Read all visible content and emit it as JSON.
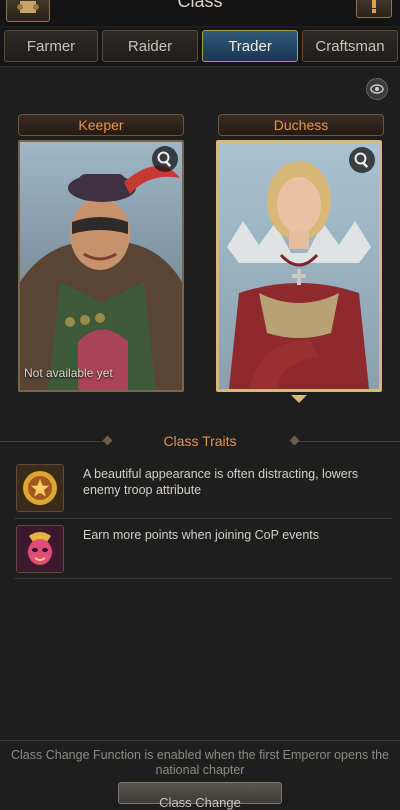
{
  "header": {
    "title": "Class",
    "back_icon": "scroll-icon",
    "info_icon": "info-icon"
  },
  "tabs": [
    {
      "label": "Farmer",
      "active": false
    },
    {
      "label": "Raider",
      "active": false
    },
    {
      "label": "Trader",
      "active": true
    },
    {
      "label": "Craftsman",
      "active": false
    }
  ],
  "view_toggle_icon": "eye-icon",
  "cards": [
    {
      "label": "Keeper",
      "status": "Not available yet",
      "selected": false
    },
    {
      "label": "Duchess",
      "status": "",
      "selected": true
    }
  ],
  "traits": {
    "title": "Class Traits",
    "items": [
      {
        "icon": "gold-medal-icon",
        "text": "A beautiful appearance is often distracting, lowers enemy troop attribute"
      },
      {
        "icon": "carnival-mask-icon",
        "text": "Earn more points when joining CoP events"
      }
    ]
  },
  "footer": {
    "note": "Class Change Function is enabled when the first Emperor opens the national chapter",
    "button_label": "Class Change"
  },
  "colors": {
    "accent": "#e59450",
    "active_tab": "#2f5a7a",
    "gold_border": "#d6b878"
  }
}
